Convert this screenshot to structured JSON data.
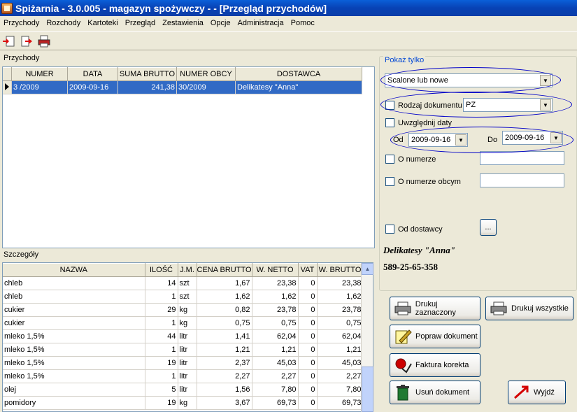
{
  "window": {
    "title": "Spiżarnia - 3.0.005 - magazyn spożywczy -  - [Przegląd przychodów]"
  },
  "menu": [
    "Przychody",
    "Rozchody",
    "Kartoteki",
    "Przegląd",
    "Zestawienia",
    "Opcje",
    "Administracja",
    "Pomoc"
  ],
  "toolbar": {
    "icons": [
      "new-document-icon",
      "export-icon",
      "print-icon"
    ]
  },
  "income": {
    "label": "Przychody",
    "headers": [
      "NUMER",
      "DATA",
      "SUMA BRUTTO",
      "NUMER OBCY",
      "DOSTAWCA"
    ],
    "rows": [
      {
        "numer": "3    /2009",
        "data": "2009-09-16",
        "suma": "241,38",
        "obcy": "30/2009",
        "dostawca": "Delikatesy \"Anna\""
      }
    ]
  },
  "details": {
    "label": "Szczegóły",
    "headers": [
      "NAZWA",
      "ILOŚĆ",
      "J.M.",
      "CENA BRUTTO",
      "W. NETTO",
      "VAT",
      "W. BRUTTO"
    ],
    "rows": [
      [
        "chleb",
        "14",
        "szt",
        "1,67",
        "23,38",
        "0",
        "23,38"
      ],
      [
        "chleb",
        "1",
        "szt",
        "1,62",
        "1,62",
        "0",
        "1,62"
      ],
      [
        "cukier",
        "29",
        "kg",
        "0,82",
        "23,78",
        "0",
        "23,78"
      ],
      [
        "cukier",
        "1",
        "kg",
        "0,75",
        "0,75",
        "0",
        "0,75"
      ],
      [
        "mleko 1,5%",
        "44",
        "litr",
        "1,41",
        "62,04",
        "0",
        "62,04"
      ],
      [
        "mleko 1,5%",
        "1",
        "litr",
        "1,21",
        "1,21",
        "0",
        "1,21"
      ],
      [
        "mleko 1,5%",
        "19",
        "litr",
        "2,37",
        "45,03",
        "0",
        "45,03"
      ],
      [
        "mleko 1,5%",
        "1",
        "litr",
        "2,27",
        "2,27",
        "0",
        "2,27"
      ],
      [
        "olej",
        "5",
        "litr",
        "1,56",
        "7,80",
        "0",
        "7,80"
      ],
      [
        "pomidory",
        "19",
        "kg",
        "3,67",
        "69,73",
        "0",
        "69,73"
      ]
    ]
  },
  "filters": {
    "legend": "Pokaż tylko",
    "status_value": "Scalone lub nowe",
    "doc_type_label": "Rodzaj dokumentu",
    "doc_type_value": "PZ",
    "dates_label": "Uwzględnij daty",
    "from_label": "Od",
    "from_value": "2009-09-16",
    "to_label": "Do",
    "to_value": "2009-09-16",
    "number_label": "O numerze",
    "foreign_number_label": "O numerze obcym",
    "supplier_label": "Od dostawcy",
    "supplier_btn": "...",
    "supplier_name": "Delikatesy \"Anna\"",
    "supplier_nip": "589-25-65-358"
  },
  "actions": {
    "print_selected": "Drukuj zaznaczony",
    "print_all": "Drukuj wszystkie",
    "edit_document": "Popraw dokument",
    "correction_invoice": "Faktura korekta",
    "delete_document": "Usuń dokument",
    "exit": "Wyjdź"
  },
  "colors": {
    "title_bar": "#0a5fd8",
    "selection": "#316ac5",
    "annotation_oval": "#0000c8"
  }
}
